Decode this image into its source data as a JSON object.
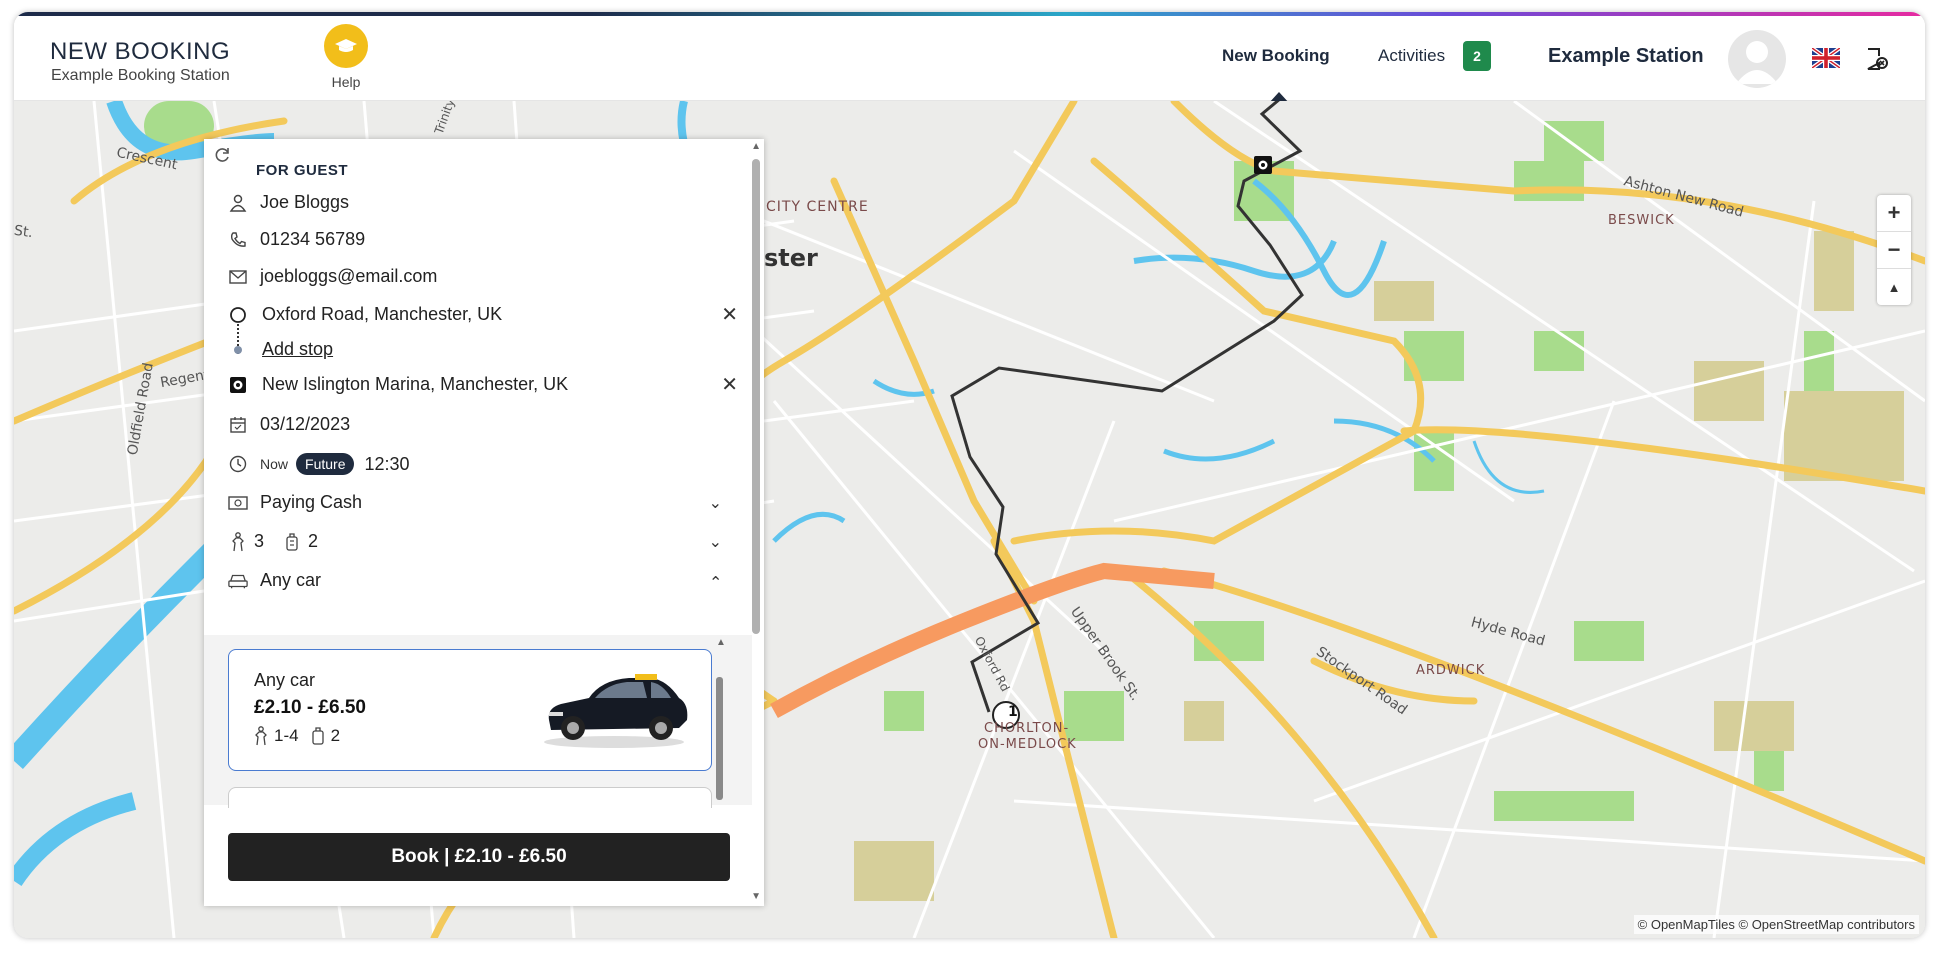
{
  "header": {
    "title": "NEW BOOKING",
    "subtitle": "Example Booking Station",
    "help_label": "Help",
    "nav": {
      "new_booking": "New Booking",
      "activities": "Activities",
      "activities_count": "2"
    },
    "station_name": "Example Station",
    "icons": [
      "graduation-cap-icon",
      "user-avatar-icon",
      "uk-flag-icon",
      "logout-icon"
    ]
  },
  "booking": {
    "section_label": "FOR GUEST",
    "name": "Joe Bloggs",
    "phone": "01234 56789",
    "email": "joebloggs@email.com",
    "pickup": "Oxford Road, Manchester, UK",
    "add_stop": "Add stop",
    "dropoff": "New Islington Marina, Manchester, UK",
    "date": "03/12/2023",
    "time_now_label": "Now",
    "time_future_label": "Future",
    "time": "12:30",
    "payment": "Paying Cash",
    "passengers": "3",
    "luggage": "2",
    "car_type": "Any car"
  },
  "car_option": {
    "name": "Any car",
    "price": "£2.10 - £6.50",
    "passengers": "1-4",
    "luggage": "2"
  },
  "book_button": "Book | £2.10 - £6.50",
  "map": {
    "labels": {
      "crescent": "Crescent",
      "st": "St.",
      "city_centre": "CITY CENTRE",
      "ster": "ster",
      "regent": "Regent",
      "oldfield": "Oldfield Road",
      "ashton": "Ashton New Road",
      "beswick": "BESWICK",
      "upper_brook": "Upper Brook St.",
      "oxford_rd": "Oxford Rd",
      "chorlton1": "CHORLTON-",
      "chorlton2": "ON-MEDLOCK",
      "hyde": "Hyde Road",
      "ardwick": "ARDWICK",
      "stockport": "Stockport Road",
      "trinity": "Trinity Wa",
      "road_left": "oad"
    },
    "zoom_in": "+",
    "zoom_out": "−",
    "compass": "▲",
    "marker_start": "1",
    "attribution": "© OpenMapTiles © OpenStreetMap contributors",
    "colors": {
      "water": "#5ec4ee",
      "park": "#a8dc8c",
      "major_road": "#f3c95b",
      "motorway": "#f79a60",
      "route": "#333333"
    }
  }
}
